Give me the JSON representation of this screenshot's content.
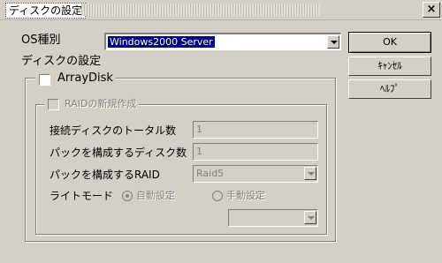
{
  "window": {
    "title": "ディスクの設定",
    "close_glyph": "×"
  },
  "os": {
    "label": "OS種別",
    "selected": "Windows2000 Server"
  },
  "disk_settings_label": "ディスクの設定",
  "arraydisk": {
    "label": "ArrayDisk",
    "checked": false
  },
  "raid_new": {
    "label": "RAIDの新規作成",
    "checked": false,
    "enabled": false
  },
  "fields": {
    "total_disks": {
      "label": "接続ディスクのトータル数",
      "value": "1"
    },
    "pack_disks": {
      "label": "パックを構成するディスク数",
      "value": "1"
    },
    "pack_raid": {
      "label": "パックを構成するRAID",
      "value": "Raid5"
    }
  },
  "write_mode": {
    "label": "ライトモード",
    "options": [
      {
        "label": "自動設定",
        "selected": true
      },
      {
        "label": "手動設定",
        "selected": false
      }
    ],
    "manual_value": ""
  },
  "buttons": {
    "ok": "OK",
    "cancel": "ｷｬﾝｾﾙ",
    "help": "ﾍﾙﾌﾟ"
  }
}
